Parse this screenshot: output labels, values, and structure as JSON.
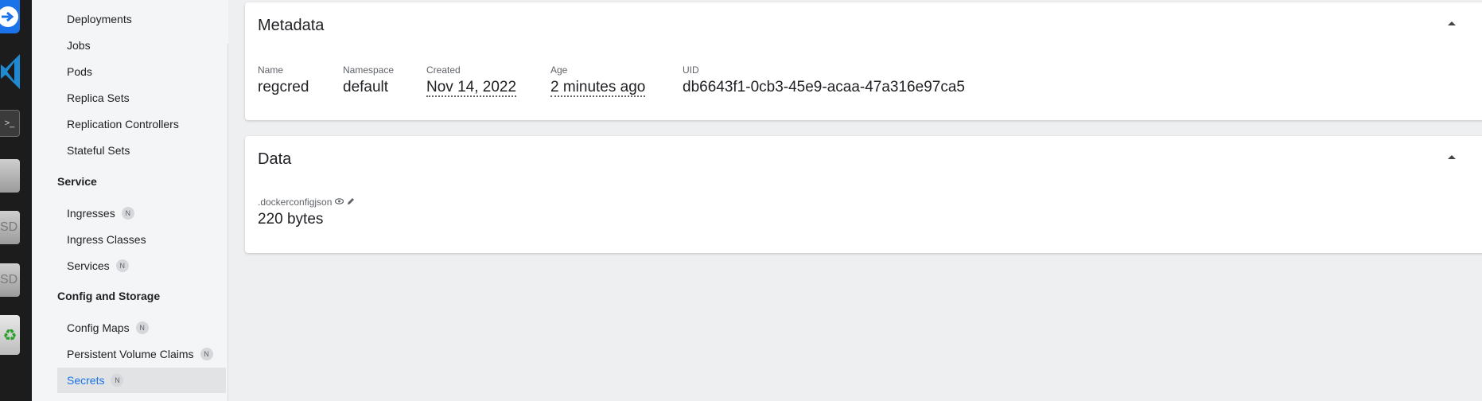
{
  "dock": {
    "term_glyph": ">_",
    "drive_label": "SD",
    "trash_glyph": "♻"
  },
  "sidebar": {
    "workloads": [
      {
        "label": "Deployments",
        "badge": ""
      },
      {
        "label": "Jobs",
        "badge": ""
      },
      {
        "label": "Pods",
        "badge": ""
      },
      {
        "label": "Replica Sets",
        "badge": ""
      },
      {
        "label": "Replication Controllers",
        "badge": ""
      },
      {
        "label": "Stateful Sets",
        "badge": ""
      }
    ],
    "service_header": "Service",
    "service": [
      {
        "label": "Ingresses",
        "badge": "N"
      },
      {
        "label": "Ingress Classes",
        "badge": ""
      },
      {
        "label": "Services",
        "badge": "N"
      }
    ],
    "config_header": "Config and Storage",
    "config": [
      {
        "label": "Config Maps",
        "badge": "N"
      },
      {
        "label": "Persistent Volume Claims",
        "badge": "N"
      },
      {
        "label": "Secrets",
        "badge": "N",
        "selected": true
      }
    ]
  },
  "metadata": {
    "title": "Metadata",
    "fields": [
      {
        "label": "Name",
        "value": "regcred"
      },
      {
        "label": "Namespace",
        "value": "default"
      },
      {
        "label": "Created",
        "value": "Nov 14, 2022"
      },
      {
        "label": "Age",
        "value": "2 minutes ago"
      },
      {
        "label": "UID",
        "value": "db6643f1-0cb3-45e9-acaa-47a316e97ca5"
      }
    ]
  },
  "data": {
    "title": "Data",
    "key": ".dockerconfigjson",
    "value": "220 bytes"
  },
  "colors": {
    "accent": "#1a73e8",
    "background": "#eeeff1",
    "sidebar": "#f4f5f6",
    "dock": "#1c1c1c"
  }
}
